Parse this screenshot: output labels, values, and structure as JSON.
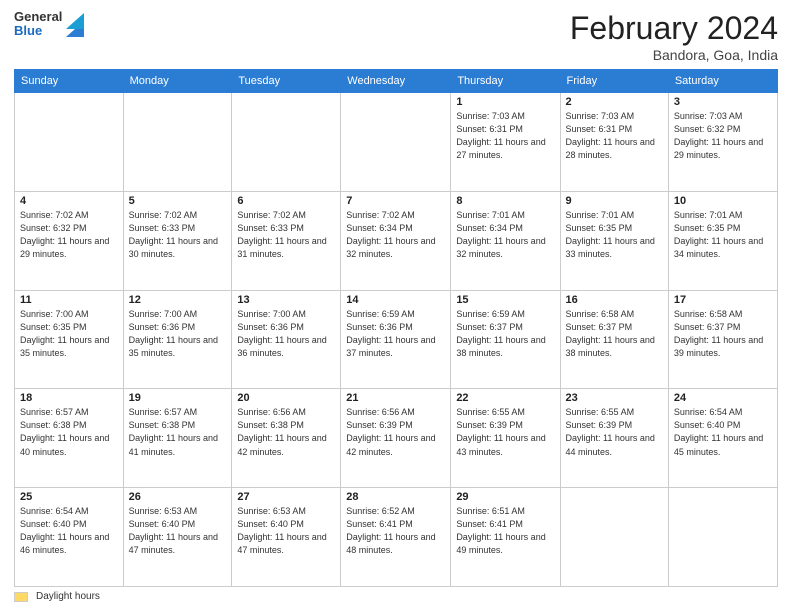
{
  "header": {
    "logo": {
      "line1": "General",
      "line2": "Blue"
    },
    "title": "February 2024",
    "location": "Bandora, Goa, India"
  },
  "days_of_week": [
    "Sunday",
    "Monday",
    "Tuesday",
    "Wednesday",
    "Thursday",
    "Friday",
    "Saturday"
  ],
  "weeks": [
    [
      {
        "day": "",
        "info": ""
      },
      {
        "day": "",
        "info": ""
      },
      {
        "day": "",
        "info": ""
      },
      {
        "day": "",
        "info": ""
      },
      {
        "day": "1",
        "info": "Sunrise: 7:03 AM\nSunset: 6:31 PM\nDaylight: 11 hours and 27 minutes."
      },
      {
        "day": "2",
        "info": "Sunrise: 7:03 AM\nSunset: 6:31 PM\nDaylight: 11 hours and 28 minutes."
      },
      {
        "day": "3",
        "info": "Sunrise: 7:03 AM\nSunset: 6:32 PM\nDaylight: 11 hours and 29 minutes."
      }
    ],
    [
      {
        "day": "4",
        "info": "Sunrise: 7:02 AM\nSunset: 6:32 PM\nDaylight: 11 hours and 29 minutes."
      },
      {
        "day": "5",
        "info": "Sunrise: 7:02 AM\nSunset: 6:33 PM\nDaylight: 11 hours and 30 minutes."
      },
      {
        "day": "6",
        "info": "Sunrise: 7:02 AM\nSunset: 6:33 PM\nDaylight: 11 hours and 31 minutes."
      },
      {
        "day": "7",
        "info": "Sunrise: 7:02 AM\nSunset: 6:34 PM\nDaylight: 11 hours and 32 minutes."
      },
      {
        "day": "8",
        "info": "Sunrise: 7:01 AM\nSunset: 6:34 PM\nDaylight: 11 hours and 32 minutes."
      },
      {
        "day": "9",
        "info": "Sunrise: 7:01 AM\nSunset: 6:35 PM\nDaylight: 11 hours and 33 minutes."
      },
      {
        "day": "10",
        "info": "Sunrise: 7:01 AM\nSunset: 6:35 PM\nDaylight: 11 hours and 34 minutes."
      }
    ],
    [
      {
        "day": "11",
        "info": "Sunrise: 7:00 AM\nSunset: 6:35 PM\nDaylight: 11 hours and 35 minutes."
      },
      {
        "day": "12",
        "info": "Sunrise: 7:00 AM\nSunset: 6:36 PM\nDaylight: 11 hours and 35 minutes."
      },
      {
        "day": "13",
        "info": "Sunrise: 7:00 AM\nSunset: 6:36 PM\nDaylight: 11 hours and 36 minutes."
      },
      {
        "day": "14",
        "info": "Sunrise: 6:59 AM\nSunset: 6:36 PM\nDaylight: 11 hours and 37 minutes."
      },
      {
        "day": "15",
        "info": "Sunrise: 6:59 AM\nSunset: 6:37 PM\nDaylight: 11 hours and 38 minutes."
      },
      {
        "day": "16",
        "info": "Sunrise: 6:58 AM\nSunset: 6:37 PM\nDaylight: 11 hours and 38 minutes."
      },
      {
        "day": "17",
        "info": "Sunrise: 6:58 AM\nSunset: 6:37 PM\nDaylight: 11 hours and 39 minutes."
      }
    ],
    [
      {
        "day": "18",
        "info": "Sunrise: 6:57 AM\nSunset: 6:38 PM\nDaylight: 11 hours and 40 minutes."
      },
      {
        "day": "19",
        "info": "Sunrise: 6:57 AM\nSunset: 6:38 PM\nDaylight: 11 hours and 41 minutes."
      },
      {
        "day": "20",
        "info": "Sunrise: 6:56 AM\nSunset: 6:38 PM\nDaylight: 11 hours and 42 minutes."
      },
      {
        "day": "21",
        "info": "Sunrise: 6:56 AM\nSunset: 6:39 PM\nDaylight: 11 hours and 42 minutes."
      },
      {
        "day": "22",
        "info": "Sunrise: 6:55 AM\nSunset: 6:39 PM\nDaylight: 11 hours and 43 minutes."
      },
      {
        "day": "23",
        "info": "Sunrise: 6:55 AM\nSunset: 6:39 PM\nDaylight: 11 hours and 44 minutes."
      },
      {
        "day": "24",
        "info": "Sunrise: 6:54 AM\nSunset: 6:40 PM\nDaylight: 11 hours and 45 minutes."
      }
    ],
    [
      {
        "day": "25",
        "info": "Sunrise: 6:54 AM\nSunset: 6:40 PM\nDaylight: 11 hours and 46 minutes."
      },
      {
        "day": "26",
        "info": "Sunrise: 6:53 AM\nSunset: 6:40 PM\nDaylight: 11 hours and 47 minutes."
      },
      {
        "day": "27",
        "info": "Sunrise: 6:53 AM\nSunset: 6:40 PM\nDaylight: 11 hours and 47 minutes."
      },
      {
        "day": "28",
        "info": "Sunrise: 6:52 AM\nSunset: 6:41 PM\nDaylight: 11 hours and 48 minutes."
      },
      {
        "day": "29",
        "info": "Sunrise: 6:51 AM\nSunset: 6:41 PM\nDaylight: 11 hours and 49 minutes."
      },
      {
        "day": "",
        "info": ""
      },
      {
        "day": "",
        "info": ""
      }
    ]
  ],
  "footer": {
    "legend_label": "Daylight hours"
  }
}
